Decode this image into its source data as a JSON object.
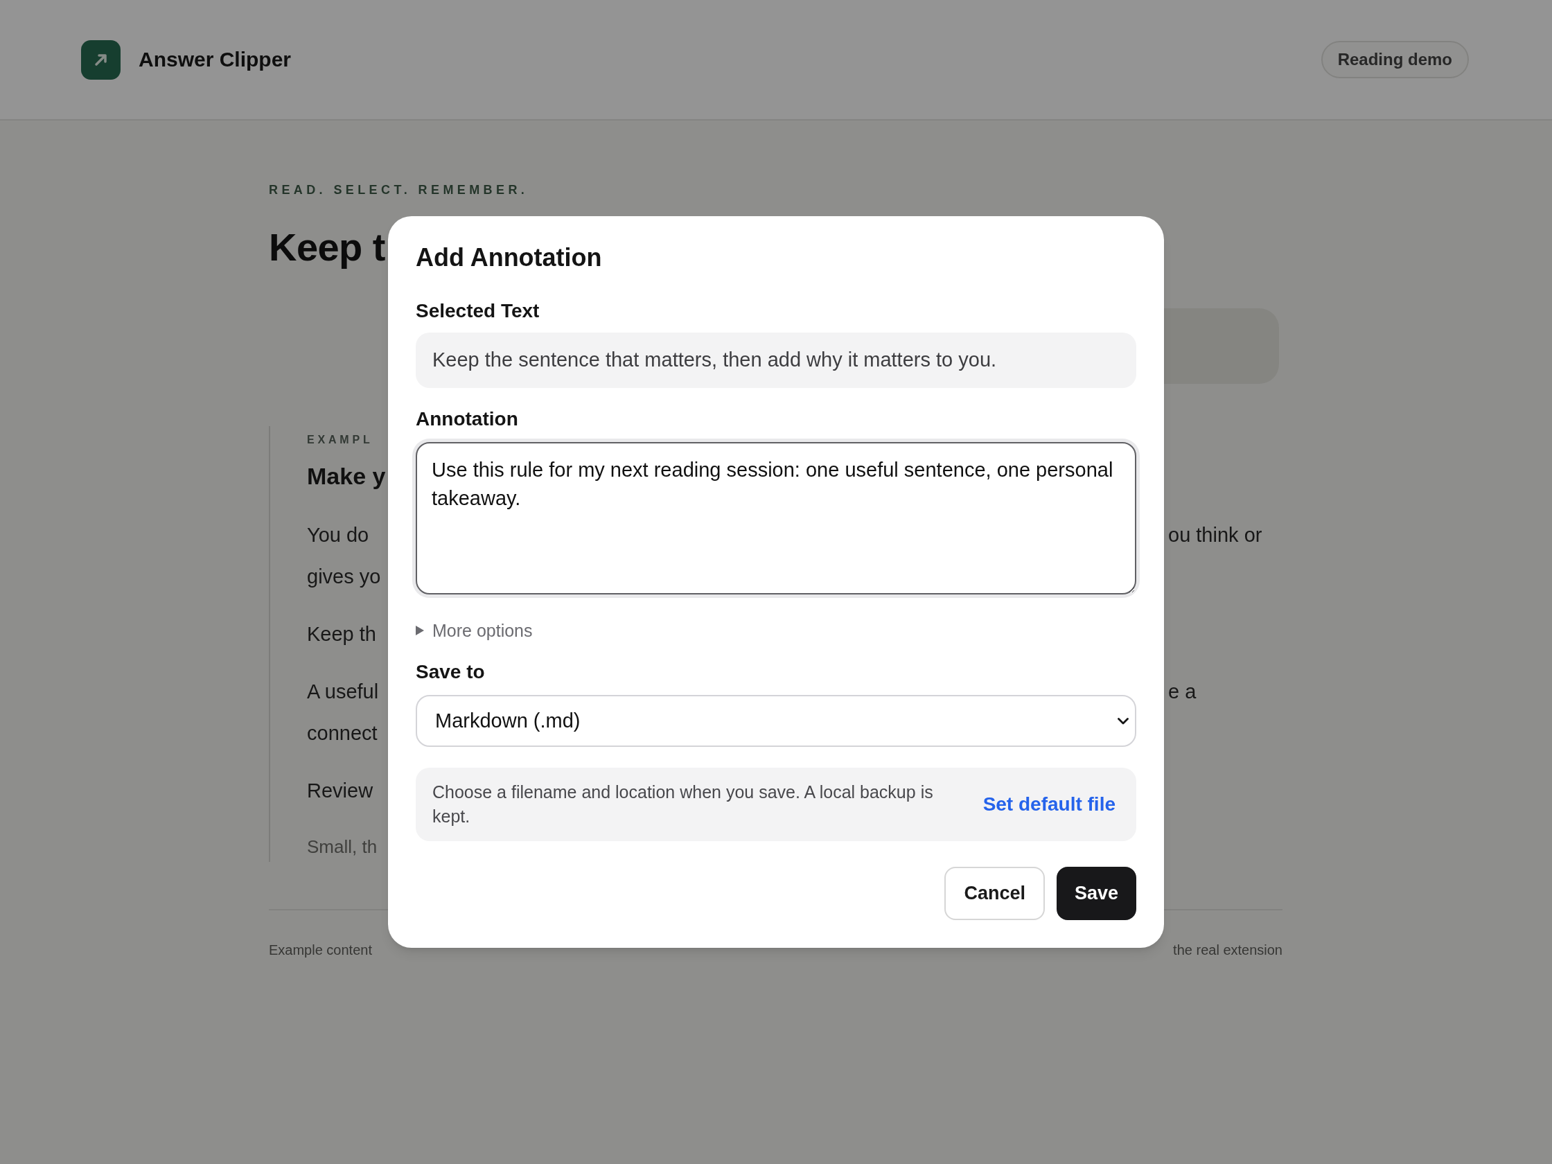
{
  "page": {
    "header": {
      "app_name": "Answer Clipper",
      "badge": "Reading demo"
    },
    "hero": {
      "eyebrow": "READ. SELECT. REMEMBER.",
      "title": "Keep t"
    },
    "article": {
      "eyebrow": "EXAMPL",
      "title": "Make y",
      "paragraphs": [
        {
          "kind": "body",
          "lines": [
            {
              "start": "You do",
              "end": "ou think or"
            },
            {
              "start": "gives yo"
            }
          ]
        },
        {
          "kind": "body",
          "lines": [
            {
              "start": "Keep th"
            }
          ]
        },
        {
          "kind": "body",
          "lines": [
            {
              "start": "A useful",
              "end": "e a"
            },
            {
              "start": "connect"
            }
          ]
        },
        {
          "kind": "body",
          "lines": [
            {
              "start": "Review"
            }
          ]
        },
        {
          "kind": "note",
          "lines": [
            {
              "start": "Small, th"
            }
          ]
        }
      ]
    },
    "footer": {
      "start": "Example content",
      "end": "the real extension"
    }
  },
  "dialog": {
    "title": "Add Annotation",
    "selected_text": {
      "label": "Selected Text",
      "value": "Keep the sentence that matters, then add why it matters to you."
    },
    "annotation": {
      "label": "Annotation",
      "value": "Use this rule for my next reading session: one useful sentence, one personal takeaway.",
      "focused": true
    },
    "more_options": {
      "label": "More options",
      "expanded": false
    },
    "save_to": {
      "label": "Save to",
      "value": "Markdown (.md)"
    },
    "note": {
      "text": "Choose a filename and location when you save. A local backup is kept.",
      "link": "Set default file"
    },
    "buttons": [
      {
        "label": "Cancel",
        "kind": "secondary"
      },
      {
        "label": "Save",
        "kind": "primary"
      }
    ]
  }
}
